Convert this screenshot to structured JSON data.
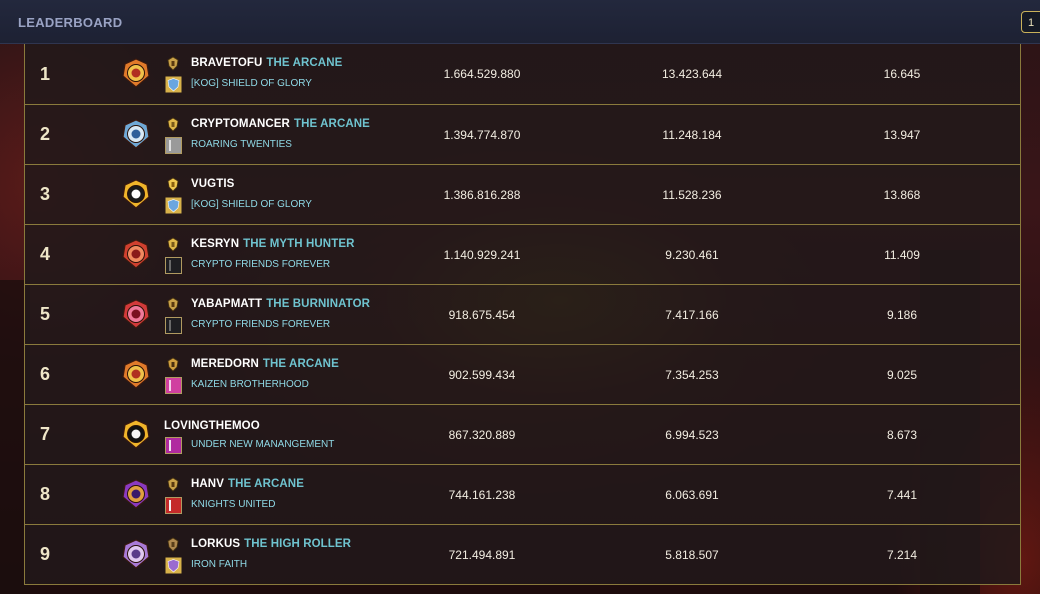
{
  "header": {
    "title": "LEADERBOARD",
    "page_indicator": "1"
  },
  "colors": {
    "frame_gold": "#8a7a3c",
    "title_accent": "#6fc3cf",
    "guild_text": "#8fd9e6",
    "header_bg": "#1d2133"
  },
  "rows": [
    {
      "rank": "1",
      "name": "BRAVETOFU",
      "title": "THE ARCANE",
      "guild": "[KOG] SHIELD OF GLORY",
      "col1": "1.664.529.880",
      "col2": "13.423.644",
      "col3": "16.645",
      "avatar": "orange-crest-icon",
      "guild_icon": "blue-shield-icon",
      "title_icon": "key-trophy-icon"
    },
    {
      "rank": "2",
      "name": "CRYPTOMANCER",
      "title": "THE ARCANE",
      "guild": "ROARING TWENTIES",
      "col1": "1.394.774.870",
      "col2": "11.248.184",
      "col3": "13.947",
      "avatar": "blue-crest-icon",
      "guild_icon": "grey-banner-icon",
      "title_icon": "gold-shield-trophy-icon"
    },
    {
      "rank": "3",
      "name": "VUGTIS",
      "title": "",
      "guild": "[KOG] SHIELD OF GLORY",
      "col1": "1.386.816.288",
      "col2": "11.528.236",
      "col3": "13.868",
      "avatar": "dark-fang-crest-icon",
      "guild_icon": "blue-shield-icon",
      "title_icon": "gold-helmet-trophy-icon"
    },
    {
      "rank": "4",
      "name": "KESRYN",
      "title": "THE MYTH HUNTER",
      "guild": "CRYPTO FRIENDS FOREVER",
      "col1": "1.140.929.241",
      "col2": "9.230.461",
      "col3": "11.409",
      "avatar": "red-crest-icon",
      "guild_icon": "dark-banner-icon",
      "title_icon": "gold-shield-trophy-icon"
    },
    {
      "rank": "5",
      "name": "YABAPMATT",
      "title": "THE BURNINATOR",
      "guild": "CRYPTO FRIENDS FOREVER",
      "col1": "918.675.454",
      "col2": "7.417.166",
      "col3": "9.186",
      "avatar": "red-pink-crest-icon",
      "guild_icon": "dark-banner-icon",
      "title_icon": "key-trophy-icon"
    },
    {
      "rank": "6",
      "name": "MEREDORN",
      "title": "THE ARCANE",
      "guild": "KAIZEN BROTHERHOOD",
      "col1": "902.599.434",
      "col2": "7.354.253",
      "col3": "9.025",
      "avatar": "orange-crest-icon",
      "guild_icon": "pink-mask-icon",
      "title_icon": "hourglass-trophy-icon"
    },
    {
      "rank": "7",
      "name": "LOVINGTHEMOO",
      "title": "",
      "guild": "UNDER NEW MANANGEMENT",
      "col1": "867.320.889",
      "col2": "6.994.523",
      "col3": "8.673",
      "avatar": "gold-fang-crest-icon",
      "guild_icon": "purple-banner-icon",
      "title_icon": ""
    },
    {
      "rank": "8",
      "name": "HANV",
      "title": "THE ARCANE",
      "guild": "KNIGHTS UNITED",
      "col1": "744.161.238",
      "col2": "6.063.691",
      "col3": "7.441",
      "avatar": "purple-crest-icon",
      "guild_icon": "red-cross-banner-icon",
      "title_icon": "key-trophy-icon"
    },
    {
      "rank": "9",
      "name": "LORKUS",
      "title": "THE HIGH ROLLER",
      "guild": "IRON FAITH",
      "col1": "721.494.891",
      "col2": "5.818.507",
      "col3": "7.214",
      "avatar": "lilac-crest-icon",
      "guild_icon": "purple-shield-icon",
      "title_icon": "bronze-shield-trophy-icon"
    }
  ]
}
